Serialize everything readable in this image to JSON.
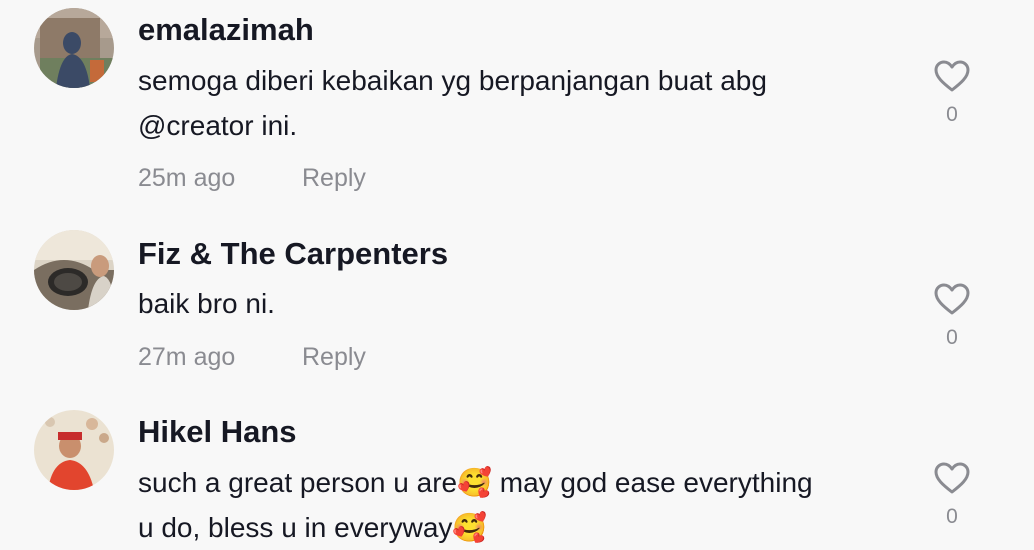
{
  "comments": [
    {
      "username": "emalazimah",
      "text_line1": "semoga diberi kebaikan yg berpanjangan buat abg",
      "text_line2": "@creator ini.",
      "time": "25m ago",
      "reply_label": "Reply",
      "like_count": "0",
      "icons": {
        "like": "heart-outline-icon"
      }
    },
    {
      "username": "Fiz & The Carpenters",
      "text_line1": "baik bro ni.",
      "time": "27m ago",
      "reply_label": "Reply",
      "like_count": "0",
      "icons": {
        "like": "heart-outline-icon"
      }
    },
    {
      "username": "Hikel Hans",
      "text_line1_a": "such a great person u are",
      "text_line1_b": " may god ease everything",
      "text_line2": "u do, bless u in everyway",
      "emoji": "🥰",
      "like_count": "0",
      "icons": {
        "like": "heart-outline-icon"
      }
    }
  ],
  "colors": {
    "background": "#f8f8f8",
    "username": "#161823",
    "text": "#161823",
    "secondary": "#8a8b91"
  }
}
